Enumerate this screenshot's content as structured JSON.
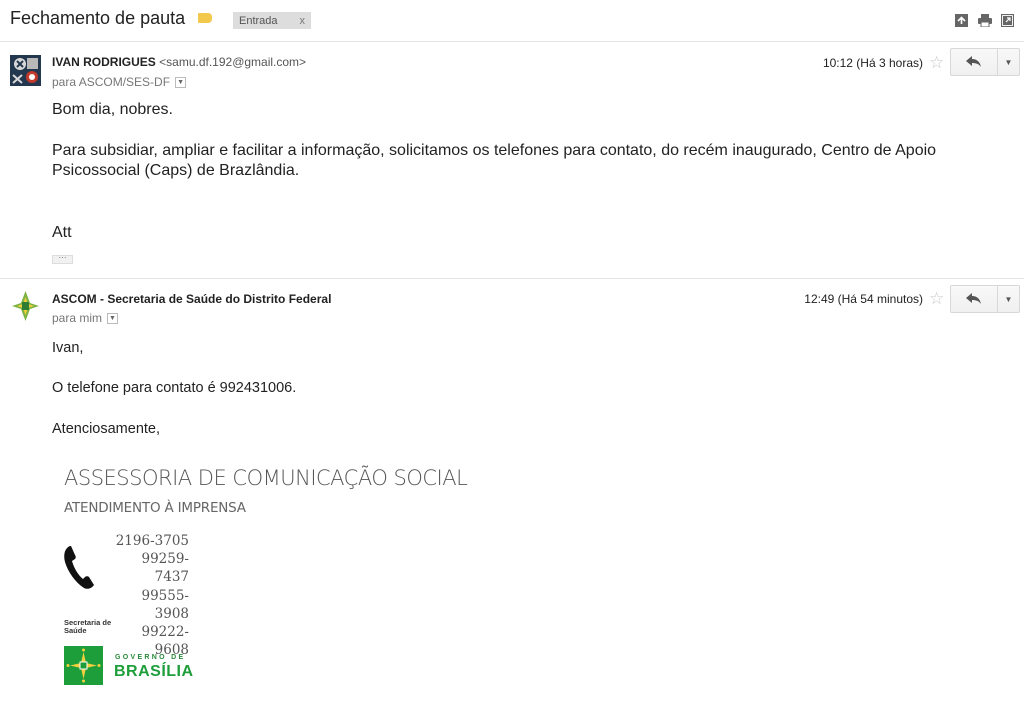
{
  "thread": {
    "subject": "Fechamento de pauta",
    "label_color": "#f2c94c",
    "inbox_label": "Entrada",
    "inbox_remove": "x",
    "header_icons": [
      "expand-all-icon",
      "print-icon",
      "new-window-icon"
    ]
  },
  "messages": [
    {
      "sender_name": "IVAN RODRIGUES",
      "sender_email": "<samu.df.192@gmail.com>",
      "recipient": "para ASCOM/SES-DF",
      "time": "10:12 (Há 3 horas)",
      "body": [
        "Bom dia, nobres.",
        "Para subsidiar, ampliar e facilitar a informação, solicitamos os telefones para contato, do recém inaugurado, Centro de Apoio Psicossocial (Caps) de Brazlândia.",
        "Att"
      ],
      "trimmed_content": "···"
    },
    {
      "sender_name": "ASCOM - Secretaria de Saúde do Distrito Federal",
      "recipient": "para mim",
      "time": "12:49 (Há 54 minutos)",
      "body": [
        "Ivan,",
        "O telefone para contato é 992431006.",
        "Atenciosamente,"
      ],
      "signature": {
        "title": "ASSESSORIA DE COMUNICAÇÃO SOCIAL",
        "subtitle": "ATENDIMENTO À IMPRENSA",
        "phones": [
          "2196-3705",
          "99259-7437",
          "99555-3908",
          "99222-9608"
        ],
        "department": "Secretaria de Saúde",
        "gov_line1": "GOVERNO DE",
        "gov_line2": "BRASÍLIA",
        "brand_color": "#1d9e3a"
      }
    }
  ]
}
